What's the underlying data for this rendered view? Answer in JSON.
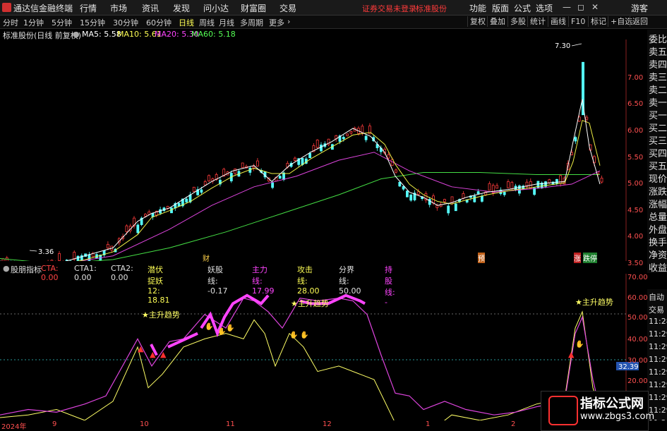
{
  "topbar": {
    "app_title": "通达信金融终端",
    "menu": [
      "行情",
      "市场",
      "资讯",
      "发现",
      "问小达",
      "财富圈",
      "交易"
    ],
    "login_notice": "证券交易未登录",
    "stock_name": "标准股份",
    "right_menu": [
      "功能",
      "版面",
      "公式",
      "选项"
    ],
    "user": "游客"
  },
  "tabbar": {
    "periods": [
      "分时",
      "1分钟",
      "5分钟",
      "15分钟",
      "30分钟",
      "60分钟",
      "日线",
      "周线",
      "月线",
      "多周期",
      "更多"
    ],
    "active": "日线",
    "right_buttons": [
      "复权",
      "叠加",
      "多股",
      "统计",
      "画线",
      "F10",
      "标记",
      "+自选",
      "返回"
    ]
  },
  "main_chart": {
    "header": "标准股份(日线 前复权)",
    "ma": [
      {
        "label": "MA5: 5.58",
        "color": "#ffffff"
      },
      {
        "label": "MA10: 5.61",
        "color": "#ffff55"
      },
      {
        "label": "MA20: 5.30",
        "color": "#ff44ff"
      },
      {
        "label": "MA60: 5.18",
        "color": "#55ff55"
      }
    ],
    "y_labels": [
      "7.00",
      "6.50",
      "6.00",
      "5.50",
      "5.00",
      "4.50",
      "4.00",
      "3.50"
    ],
    "high_marker": "7.30",
    "low_marker": "3.36",
    "tags": [
      "财",
      "预",
      "涨",
      "跌停"
    ]
  },
  "sidebar": [
    "委比",
    "卖五",
    "卖四",
    "卖三",
    "卖二",
    "卖一",
    "买一",
    "买二",
    "买三",
    "买四",
    "买五",
    "现价",
    "涨跌",
    "涨幅",
    "总量",
    "外盘",
    "换手",
    "净资",
    "收益"
  ],
  "sub_chart": {
    "name": "股朋指标",
    "params": [
      {
        "label": "CTA: 0.00",
        "color": "#ff4444"
      },
      {
        "label": "CTA1: 0.00",
        "color": "#e0e0e0"
      },
      {
        "label": "CTA2: 0.00",
        "color": "#e0e0e0"
      },
      {
        "label": "潜伏捉妖12: 18.81",
        "color": "#ffff55"
      },
      {
        "label": "妖股线: -0.17",
        "color": "#e0e0e0"
      },
      {
        "label": "主力线: 17.99",
        "color": "#ff44ff"
      },
      {
        "label": "攻击线: 28.00",
        "color": "#ffff55"
      },
      {
        "label": "分界线: 50.00",
        "color": "#e0e0e0"
      },
      {
        "label": "持股线: -",
        "color": "#ff44ff"
      }
    ],
    "y_labels": [
      "70.00",
      "60.00",
      "50.00",
      "40.00",
      "30.00",
      "20.00"
    ],
    "current_value": "32.39",
    "signal_text": "主升趋势"
  },
  "time_side": [
    "自动",
    "交易",
    "11:28",
    "11:29",
    "11:29",
    "11:29",
    "11:29",
    "11:29",
    "11:29",
    "11:29",
    "11:29"
  ],
  "x_axis": [
    "2024年",
    "9",
    "10",
    "11",
    "12",
    "1",
    "2"
  ],
  "watermark": {
    "title": "指标公式网",
    "url": "www.zbgs3.com"
  },
  "colors": {
    "up": "#ff3b3b",
    "down": "#55ffff",
    "ma5": "#ffffff",
    "ma10": "#ffff55",
    "ma20": "#ff44ff",
    "ma60": "#55ff55"
  }
}
